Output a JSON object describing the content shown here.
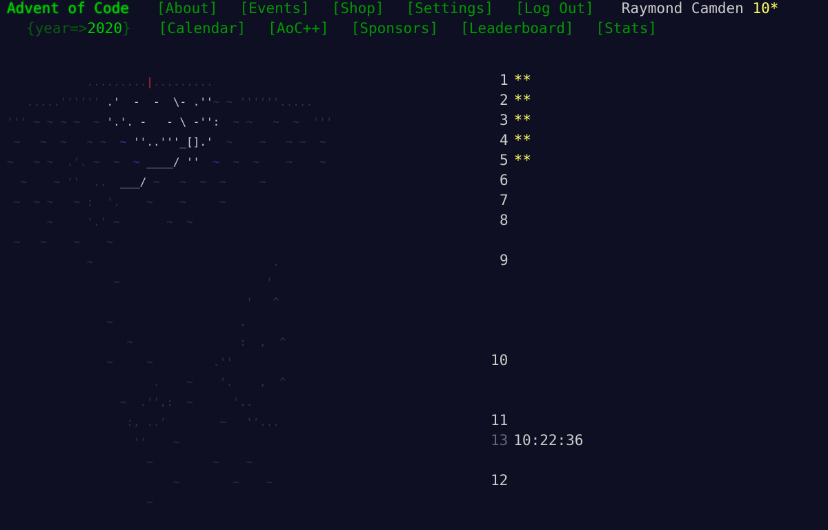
{
  "header": {
    "title": "Advent of Code",
    "nav1": [
      "[About]",
      "[Events]",
      "[Shop]",
      "[Settings]",
      "[Log Out]"
    ],
    "user_name": "Raymond Camden",
    "user_stars": "10*",
    "year_prefix": "{year=>",
    "year_value": "2020",
    "year_suffix": "}",
    "nav2": [
      "[Calendar]",
      "[AoC++]",
      "[Sponsors]",
      "[Leaderboard]",
      "[Stats]"
    ]
  },
  "calendar": {
    "days": [
      {
        "label": "1",
        "stars": "**"
      },
      {
        "label": "2",
        "stars": "**"
      },
      {
        "label": "3",
        "stars": "**"
      },
      {
        "label": "4",
        "stars": "**"
      },
      {
        "label": "5",
        "stars": "**"
      },
      {
        "label": "6",
        "stars": ""
      },
      {
        "label": "7",
        "stars": ""
      },
      {
        "label": "8",
        "stars": ""
      },
      {
        "label": "9",
        "stars": ""
      },
      {
        "label": "10",
        "stars": ""
      },
      {
        "label": "11",
        "stars": ""
      },
      {
        "label": "12",
        "stars": ""
      },
      {
        "label": "13",
        "stars": ""
      }
    ],
    "countdown": "10:22:36"
  },
  "colors": {
    "background": "#0f0f23",
    "link": "#009900",
    "title": "#00cc00",
    "star": "#ffff66",
    "text": "#cccccc"
  }
}
